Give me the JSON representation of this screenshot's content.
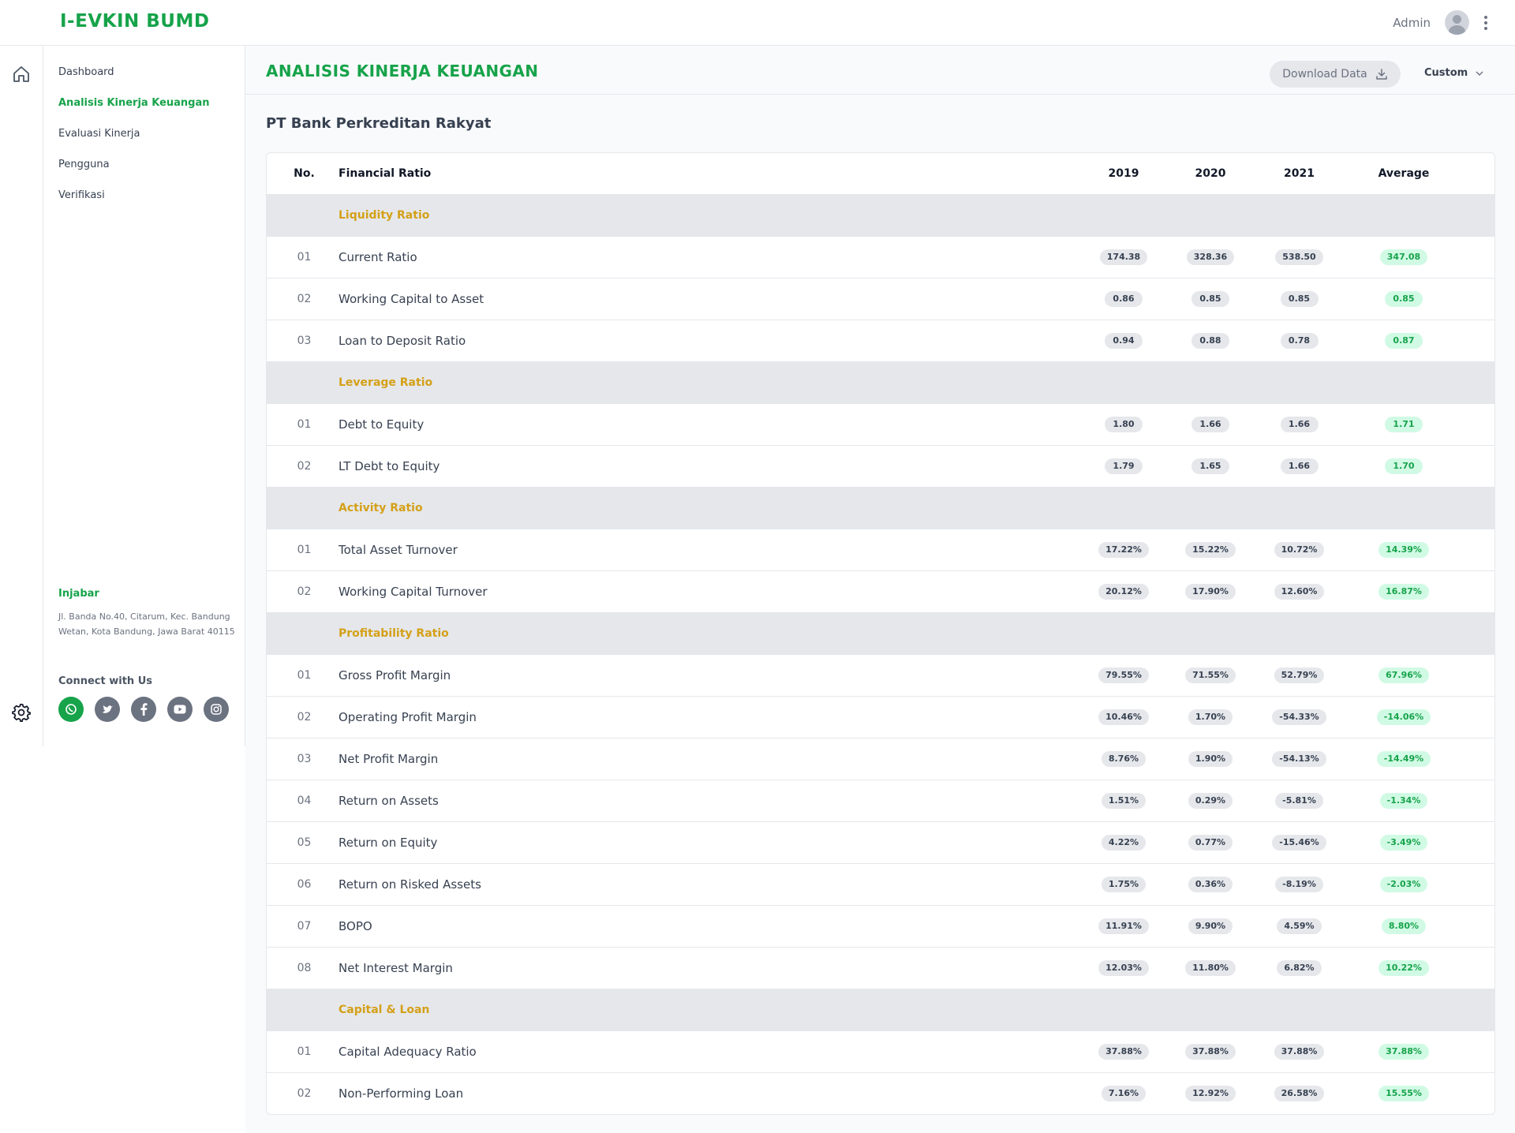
{
  "app": {
    "logo": "I-EVKIN BUMD",
    "user_name": "Admin"
  },
  "sidebar": {
    "items": [
      {
        "label": "Dashboard",
        "active": false
      },
      {
        "label": "Analisis Kinerja Keuangan",
        "active": true
      },
      {
        "label": "Evaluasi Kinerja",
        "active": false
      },
      {
        "label": "Pengguna",
        "active": false
      },
      {
        "label": "Verifikasi",
        "active": false
      }
    ],
    "company_name": "Injabar",
    "company_address": "Jl. Banda No.40, Citarum, Kec. Bandung Wetan, Kota Bandung, Jawa Barat 40115",
    "connect_title": "Connect with Us",
    "socials": [
      "whatsapp-icon",
      "twitter-icon",
      "facebook-icon",
      "youtube-icon",
      "instagram-icon"
    ]
  },
  "header": {
    "title": "ANALISIS KINERJA KEUANGAN",
    "download_label": "Download Data",
    "period_label": "Custom"
  },
  "company_title": "PT Bank Perkreditan Rakyat",
  "table": {
    "headers": {
      "no": "No.",
      "name": "Financial Ratio",
      "y1": "2019",
      "y2": "2020",
      "y3": "2021",
      "avg": "Average"
    },
    "groups": [
      {
        "label": "Liquidity Ratio",
        "rows": [
          {
            "no": "01",
            "name": "Current Ratio",
            "y1": "174.38",
            "y2": "328.36",
            "y3": "538.50",
            "avg": "347.08"
          },
          {
            "no": "02",
            "name": "Working Capital to Asset",
            "y1": "0.86",
            "y2": "0.85",
            "y3": "0.85",
            "avg": "0.85"
          },
          {
            "no": "03",
            "name": "Loan to Deposit Ratio",
            "y1": "0.94",
            "y2": "0.88",
            "y3": "0.78",
            "avg": "0.87"
          }
        ]
      },
      {
        "label": "Leverage Ratio",
        "rows": [
          {
            "no": "01",
            "name": "Debt to Equity",
            "y1": "1.80",
            "y2": "1.66",
            "y3": "1.66",
            "avg": "1.71"
          },
          {
            "no": "02",
            "name": "LT Debt to Equity",
            "y1": "1.79",
            "y2": "1.65",
            "y3": "1.66",
            "avg": "1.70"
          }
        ]
      },
      {
        "label": "Activity Ratio",
        "rows": [
          {
            "no": "01",
            "name": "Total Asset Turnover",
            "y1": "17.22%",
            "y2": "15.22%",
            "y3": "10.72%",
            "avg": "14.39%"
          },
          {
            "no": "02",
            "name": "Working Capital Turnover",
            "y1": "20.12%",
            "y2": "17.90%",
            "y3": "12.60%",
            "avg": "16.87%"
          }
        ]
      },
      {
        "label": "Profitability Ratio",
        "rows": [
          {
            "no": "01",
            "name": "Gross Profit Margin",
            "y1": "79.55%",
            "y2": "71.55%",
            "y3": "52.79%",
            "avg": "67.96%"
          },
          {
            "no": "02",
            "name": "Operating Profit Margin",
            "y1": "10.46%",
            "y2": "1.70%",
            "y3": "-54.33%",
            "avg": "-14.06%"
          },
          {
            "no": "03",
            "name": "Net Profit Margin",
            "y1": "8.76%",
            "y2": "1.90%",
            "y3": "-54.13%",
            "avg": "-14.49%"
          },
          {
            "no": "04",
            "name": "Return on Assets",
            "y1": "1.51%",
            "y2": "0.29%",
            "y3": "-5.81%",
            "avg": "-1.34%"
          },
          {
            "no": "05",
            "name": "Return on Equity",
            "y1": "4.22%",
            "y2": "0.77%",
            "y3": "-15.46%",
            "avg": "-3.49%"
          },
          {
            "no": "06",
            "name": "Return on Risked Assets",
            "y1": "1.75%",
            "y2": "0.36%",
            "y3": "-8.19%",
            "avg": "-2.03%"
          },
          {
            "no": "07",
            "name": "BOPO",
            "y1": "11.91%",
            "y2": "9.90%",
            "y3": "4.59%",
            "avg": "8.80%"
          },
          {
            "no": "08",
            "name": "Net Interest Margin",
            "y1": "12.03%",
            "y2": "11.80%",
            "y3": "6.82%",
            "avg": "10.22%"
          }
        ]
      },
      {
        "label": "Capital & Loan",
        "rows": [
          {
            "no": "01",
            "name": "Capital Adequacy Ratio",
            "y1": "37.88%",
            "y2": "37.88%",
            "y3": "37.88%",
            "avg": "37.88%"
          },
          {
            "no": "02",
            "name": "Non-Performing Loan",
            "y1": "7.16%",
            "y2": "12.92%",
            "y3": "26.58%",
            "avg": "15.55%"
          }
        ]
      }
    ]
  },
  "colors": {
    "brand": "#16a34a",
    "group_label": "#d4a017",
    "group_bg": "#e5e7eb",
    "pill_bg": "#e5e7eb",
    "avg_pill_bg": "#d1fae5"
  }
}
